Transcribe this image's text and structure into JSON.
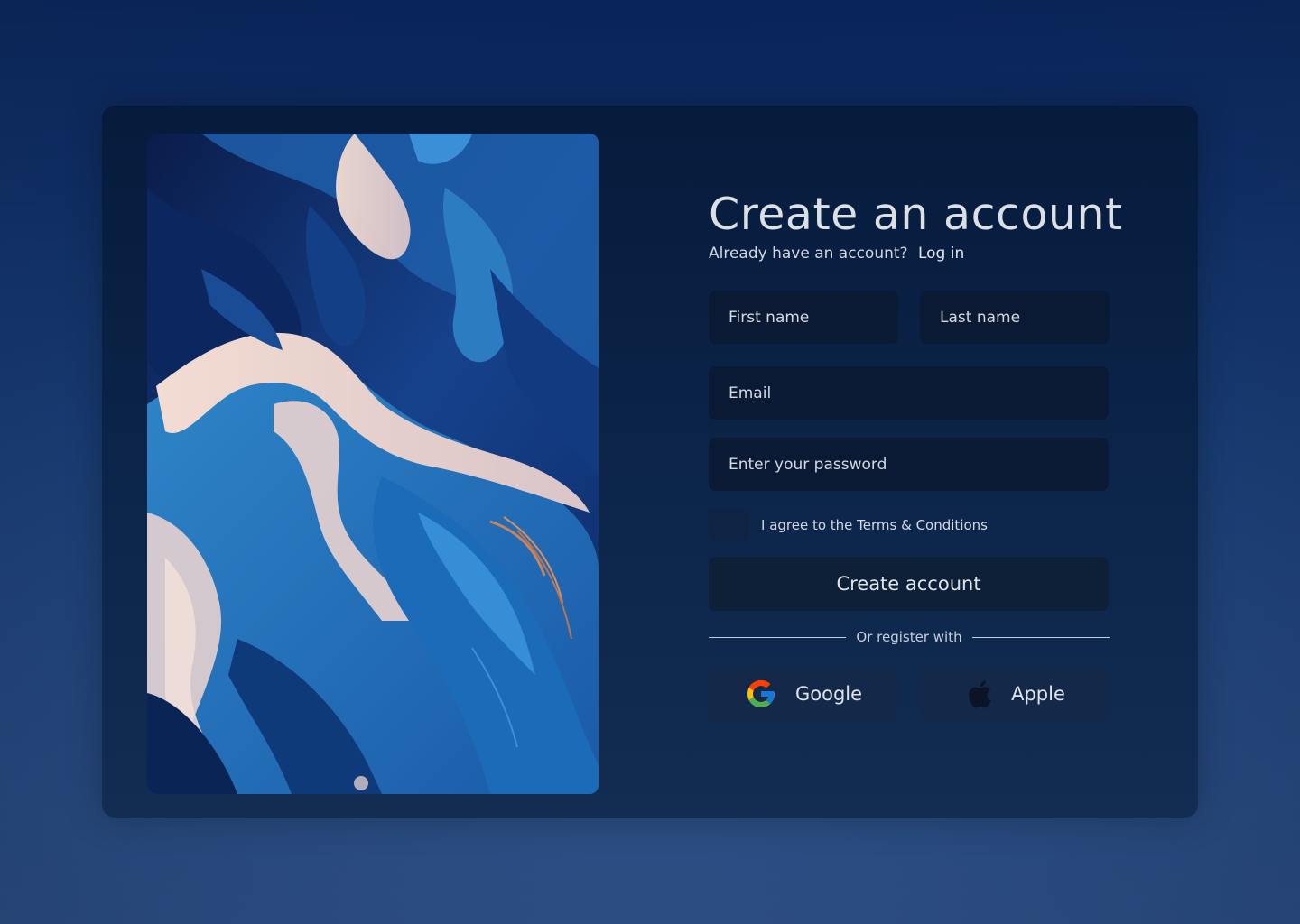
{
  "form": {
    "title": "Create an account",
    "subtitle": "Already have an account?",
    "login_link": "Log in",
    "first_name_placeholder": "First name",
    "last_name_placeholder": "Last name",
    "email_placeholder": "Email",
    "password_placeholder": "Enter your password",
    "terms_label": "I agree to the Terms & Conditions",
    "terms_checked": false,
    "submit_label": "Create account",
    "divider_label": "Or register with",
    "social": [
      {
        "label": "Google",
        "icon": "google-icon"
      },
      {
        "label": "Apple",
        "icon": "apple-icon"
      }
    ]
  },
  "colors": {
    "background_top": "#082359",
    "background_bottom": "#2f5288",
    "card": "#061b3c",
    "field": "#0a1a34",
    "text": "#d5d9e2"
  }
}
